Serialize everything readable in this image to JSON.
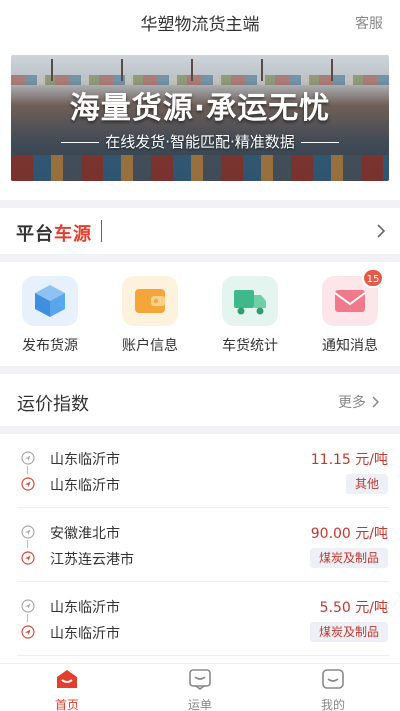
{
  "header": {
    "title": "华塑物流货主端",
    "service_label": "客服"
  },
  "banner": {
    "headline": "海量货源·承运无忧",
    "subline": "在线发货·智能匹配·精准数据"
  },
  "platform": {
    "logo_part1": "平台",
    "logo_part2": "车源"
  },
  "quick_actions": [
    {
      "label": "发布货源",
      "icon": "cube-icon"
    },
    {
      "label": "账户信息",
      "icon": "wallet-icon"
    },
    {
      "label": "车货统计",
      "icon": "truck-icon"
    },
    {
      "label": "通知消息",
      "icon": "mail-icon",
      "badge": "15"
    }
  ],
  "freight": {
    "title": "运价指数",
    "more_label": "更多",
    "routes": [
      {
        "from": "山东临沂市",
        "to": "山东临沂市",
        "price": "11.15 元/吨",
        "tag": "其他"
      },
      {
        "from": "安徽淮北市",
        "to": "江苏连云港市",
        "price": "90.00 元/吨",
        "tag": "煤炭及制品"
      },
      {
        "from": "山东临沂市",
        "to": "山东临沂市",
        "price": "5.50 元/吨",
        "tag": "煤炭及制品"
      }
    ]
  },
  "tabbar": {
    "tabs": [
      {
        "label": "首页",
        "active": true
      },
      {
        "label": "运单",
        "active": false
      },
      {
        "label": "我的",
        "active": false
      }
    ]
  },
  "colors": {
    "accent": "#e0402d",
    "price": "#c0392b",
    "tag_bg": "#eef0f8"
  }
}
